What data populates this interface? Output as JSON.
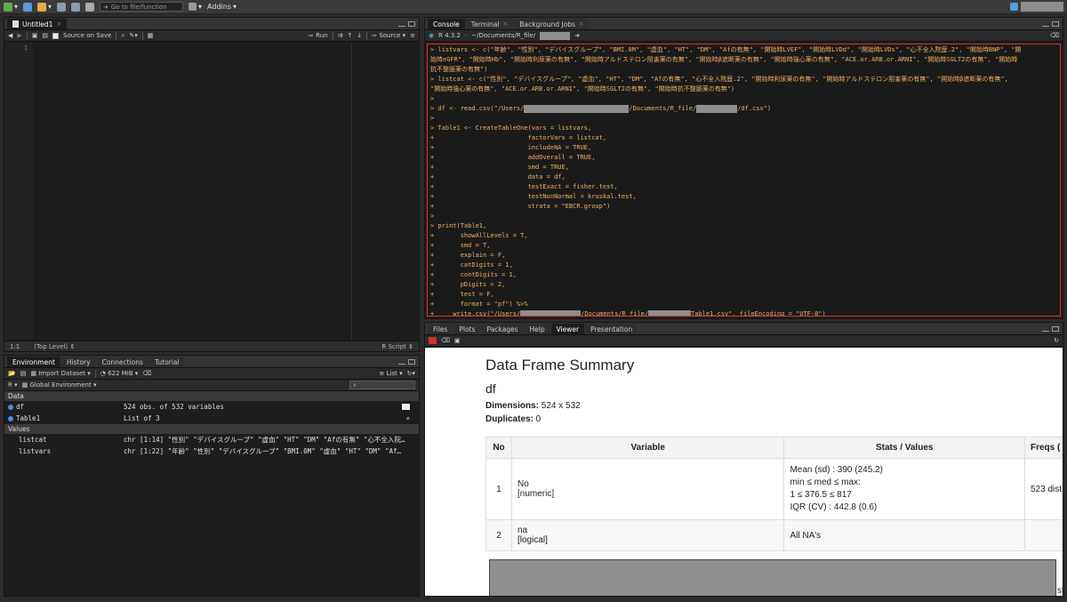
{
  "topbar": {
    "goto_label": "Go to file/function",
    "addins_label": "Addins"
  },
  "source_pane": {
    "tab_label": "Untitled1",
    "source_on_save": "Source on Save",
    "run_label": "Run",
    "source_label": "Source",
    "line_number": "1",
    "cursor_pos": "1:1",
    "scope": "(Top Level)",
    "file_type": "R Script"
  },
  "env_pane": {
    "tabs": [
      "Environment",
      "History",
      "Connections",
      "Tutorial"
    ],
    "import_dataset": "Import Dataset",
    "memory": "622 MiB",
    "view_mode": "List",
    "lang": "R",
    "scope": "Global Environment",
    "section_data": "Data",
    "section_values": "Values",
    "data_rows": [
      {
        "name": "df",
        "value": "524 obs. of 532 variables"
      },
      {
        "name": "Table1",
        "value": "List of  3"
      }
    ],
    "value_rows": [
      {
        "name": "listcat",
        "value": "chr [1:14] \"性別\" \"デバイスグループ\" \"虚血\" \"HT\" \"DM\" \"Afの有無\" \"心不全入院…"
      },
      {
        "name": "listvars",
        "value": "chr [1:22] \"年齢\" \"性別\" \"デバイスグループ\" \"BMI.0M\" \"虚血\" \"HT\" \"DM\" \"Af…"
      }
    ]
  },
  "console_pane": {
    "tabs": [
      "Console",
      "Terminal",
      "Background Jobs"
    ],
    "r_version": "R 4.3.2",
    "path_prefix": "~/Documents/R_file/",
    "lines": [
      "> listvars <- c(\"年齢\", \"性別\", \"デバイスグループ\", \"BMI.0M\", \"虚血\", \"HT\", \"DM\", \"Afの有無\", \"開始時LVEF\", \"開始時LVDd\", \"開始時LVDs\", \"心不全入院歴.2\", \"開始時BNP\", \"開",
      "始時eGFR\", \"開始時Hb\", \"開始時利尿薬の有無\", \"開始時アルドステロン阻害薬の有無\", \"開始時β遮断薬の有無\", \"開始時強心薬の有無\", \"ACE.or.ARB.or.ARNI\", \"開始時SGLT2の有無\", \"開始時",
      "抗不整脈薬の有無\")",
      "> listcat <- c(\"性別\", \"デバイスグループ\", \"虚血\", \"HT\", \"DM\", \"Afの有無\", \"心不全入院歴.2\", \"開始時利尿薬の有無\", \"開始時アルドステロン阻害薬の有無\", \"開始時β遮断薬の有無\",",
      "\"開始時強心薬の有無\", \"ACE.or.ARB.or.ARNI\", \"開始時SGLT2の有無\", \"開始時抗不整脈薬の有無\")",
      ">",
      "> df <- read.csv(\"/Users/",
      ">",
      "> Table1 <- CreateTableOne(vars = listvars,",
      "+                         factorVars = listcat,",
      "+                         includeNA = TRUE,",
      "+                         addOverall = TRUE,",
      "+                         smd = TRUE,",
      "+                         data = df,",
      "+                         testExact = fisher.test,",
      "+                         testNonNormal = kruskal.test,",
      "+                         strata = \"EBCR.group\")",
      ">",
      "> print(Table1,",
      "+       showAllLevels = T,",
      "+       smd = T,",
      "+       explain = F,",
      "+       catDigits = 1,",
      "+       contDigits = 1,",
      "+       pDigits = 2,",
      "+       test = F,",
      "+       format = \"pf\") %>%",
      "+     write.csv(\"/Users/"
    ],
    "read_mid": "/Documents/R_file/",
    "read_end": "/df.csv\")",
    "write_mid": "/Documents/R_file/",
    "write_end": "Table1.csv\", fileEncoding = \"UTF-8\")"
  },
  "viewer_pane": {
    "tabs": [
      "Files",
      "Plots",
      "Packages",
      "Help",
      "Viewer",
      "Presentation"
    ],
    "title": "Data Frame Summary",
    "df_name": "df",
    "dimensions_label": "Dimensions:",
    "dimensions_value": " 524 x 532",
    "duplicates_label": "Duplicates:",
    "duplicates_value": " 0",
    "headers": [
      "No",
      "Variable",
      "Stats / Values",
      "Freqs ("
    ],
    "rows": [
      {
        "no": "1",
        "var": "No",
        "type": "[numeric]",
        "stats": [
          "Mean (sd) : 390 (245.2)",
          "min ≤ med ≤ max:",
          "1 ≤ 376.5 ≤ 817",
          "IQR (CV) : 442.8 (0.6)"
        ],
        "freq": "523 dist"
      },
      {
        "no": "2",
        "var": "na",
        "type": "[logical]",
        "stats": [
          "All NA's"
        ],
        "freq": ""
      }
    ],
    "trailing": "st"
  }
}
